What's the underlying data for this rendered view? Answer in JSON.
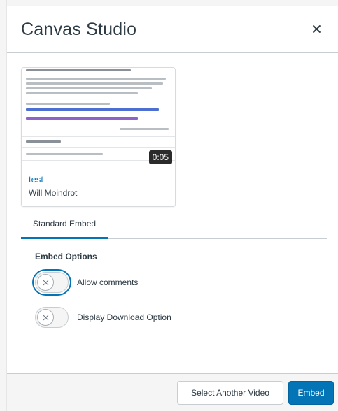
{
  "modal": {
    "title": "Canvas Studio",
    "close_label": "Close"
  },
  "video": {
    "title": "test",
    "author": "Will Moindrot",
    "duration": "0:05"
  },
  "tabs": [
    {
      "label": "Standard Embed",
      "selected": true
    }
  ],
  "embed_options": {
    "heading": "Embed Options",
    "allow_comments": {
      "label": "Allow comments",
      "checked": false
    },
    "download_option": {
      "label": "Display Download Option",
      "checked": false
    }
  },
  "footer": {
    "select_another_label": "Select Another Video",
    "embed_label": "Embed"
  },
  "colors": {
    "accent": "#0374b5",
    "text": "#2d3b45",
    "border": "#c7cdd1",
    "footer_bg": "#f5f5f5"
  }
}
